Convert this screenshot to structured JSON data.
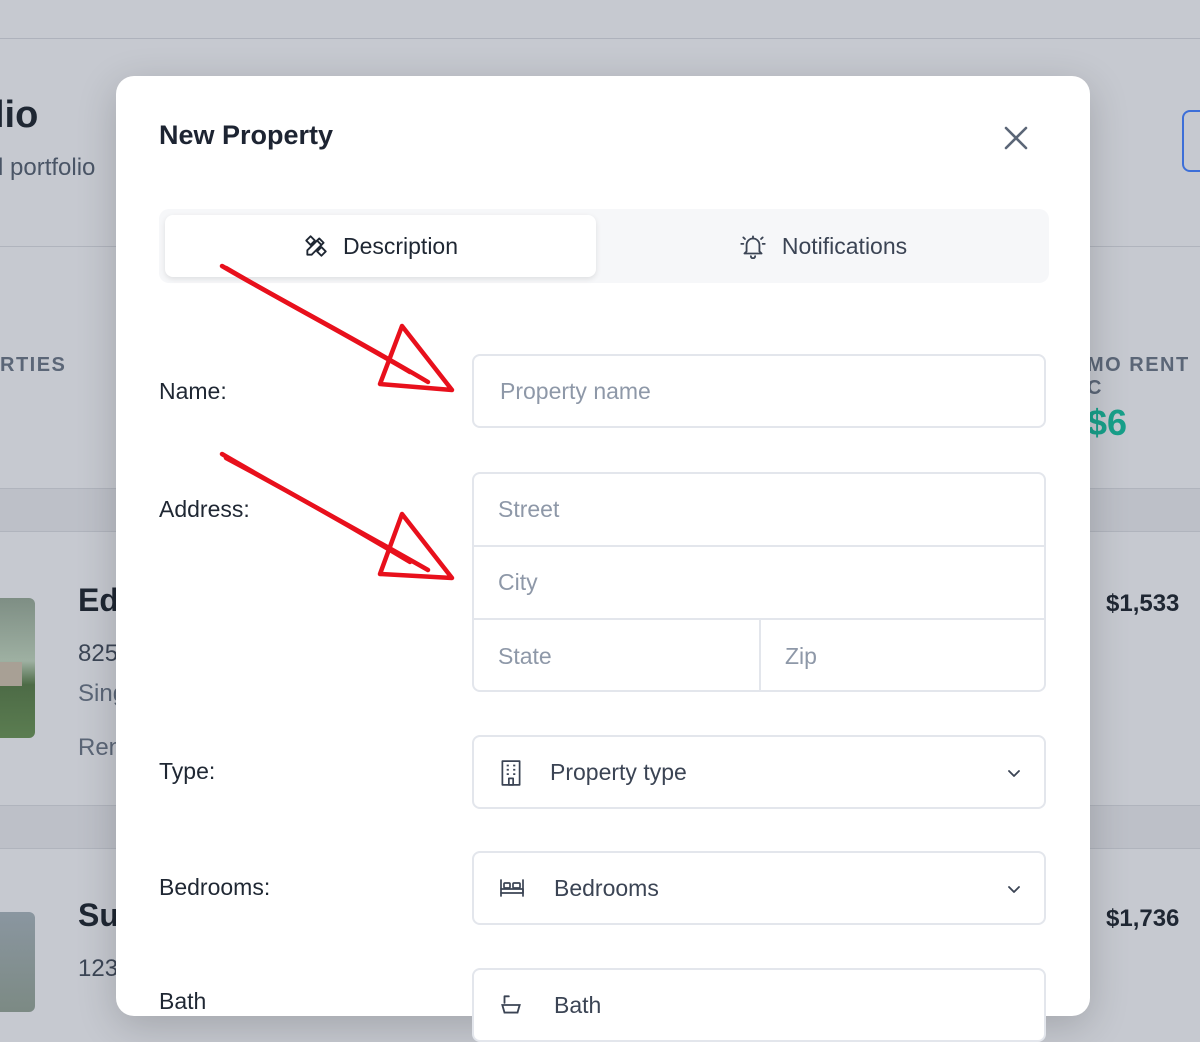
{
  "background": {
    "header_title": "lio",
    "header_subtitle": "l portfolio",
    "stat_label_left": "RTIES",
    "stat_label_right": "MO RENT C",
    "stat_value_right": "$6",
    "stat_tick": ".",
    "cards": [
      {
        "title": "Ed",
        "line1": "825",
        "line2": "Sing",
        "line3": "Ren",
        "price": "$1,533"
      },
      {
        "title": "Su",
        "line1": "123",
        "price": "$1,736"
      }
    ]
  },
  "modal": {
    "title": "New Property",
    "tabs": [
      {
        "label": "Description",
        "icon": "pencil-ruler-icon",
        "active": true
      },
      {
        "label": "Notifications",
        "icon": "bell-ringing-icon",
        "active": false
      }
    ],
    "fields": {
      "name": {
        "label": "Name:",
        "placeholder": "Property name"
      },
      "address": {
        "label": "Address:",
        "street_placeholder": "Street",
        "city_placeholder": "City",
        "state_placeholder": "State",
        "zip_placeholder": "Zip"
      },
      "type": {
        "label": "Type:",
        "placeholder": "Property type",
        "icon": "building-icon"
      },
      "bedrooms": {
        "label": "Bedrooms:",
        "placeholder": "Bedrooms",
        "icon": "bed-icon"
      },
      "bathrooms": {
        "label": "Bath",
        "placeholder": "Bath",
        "icon": "bath-icon"
      }
    }
  },
  "annotation": {
    "arrow_color": "#e8101c"
  },
  "colors": {
    "accent_teal": "#18a08a",
    "accent_blue": "#3d6fd8",
    "overlay": "#c6c9d0",
    "input_border": "#e3e6ec",
    "placeholder": "#8e98a8"
  }
}
